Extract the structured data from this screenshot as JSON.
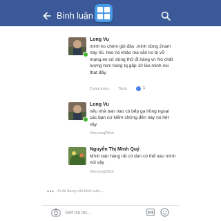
{
  "header": {
    "title": "Bình luận",
    "accent": "#3b5998"
  },
  "comments": [
    {
      "author": "Long Vu",
      "text": "minh ko chém gió đâu .minh dùng 2nam nay rồi. heo nó khảo ma vẫn ko bị vỡ mạng.ee cứ dùng thử đi.hàng vn Nó chất lượng hơn hang tq gấp 10 lần.minh noi that đấy.",
      "time": "2 phút trước",
      "like_label": "Thích",
      "like_count": "1",
      "online": true
    },
    {
      "author": "Long Vu",
      "text": "nếu nhà ban nào có bếp ga hồng ngoại các bạn cứ kiếm chứng.đên này nó hệt vậy",
      "time": "Vừa xong",
      "like_label": "Thích",
      "online": true
    },
    {
      "author": "Nguyễn Thị Minh Quý",
      "text": "Mình bán hàng rất có tâm có thể nào mình nói vậy",
      "time": "Vừa xong",
      "like_label": "Thích",
      "online": false
    }
  ],
  "typing_indicator": "Ai đó đang viết bình luận...",
  "composer": {
    "placeholder": "Viết trả lời..."
  },
  "icons": {
    "back": "arrow-left-icon",
    "search": "search-icon",
    "camera": "camera-icon",
    "gif": "gif-icon",
    "emoji": "emoji-icon"
  }
}
